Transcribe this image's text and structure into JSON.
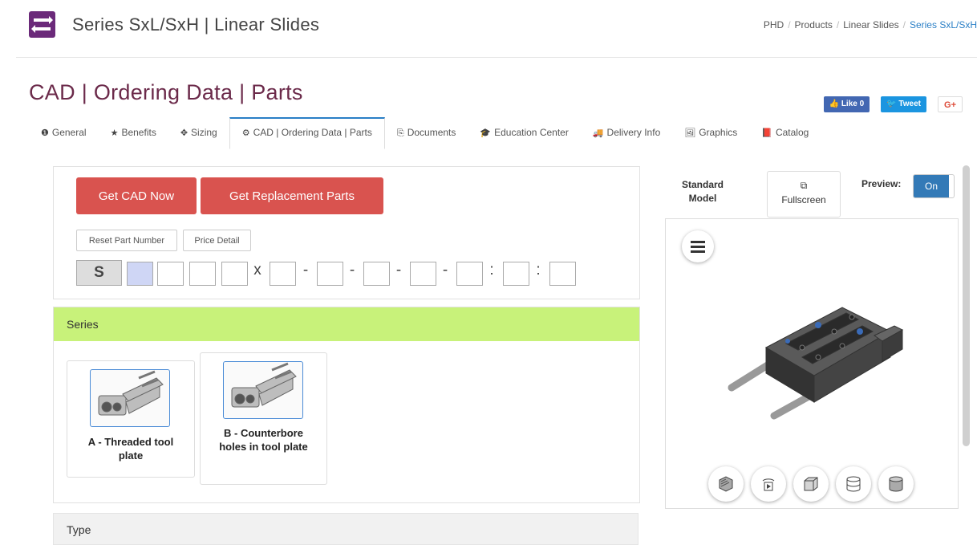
{
  "header": {
    "title": "Series SxL/SxH | Linear Slides",
    "breadcrumb": [
      "PHD",
      "Products",
      "Linear Slides",
      "Series SxL/SxH"
    ]
  },
  "page": {
    "title": "CAD | Ordering Data | Parts"
  },
  "social": {
    "like": "Like 0",
    "tweet": "Tweet",
    "gplus": "G+"
  },
  "tabs": [
    {
      "label": "General",
      "icon": "info-icon"
    },
    {
      "label": "Benefits",
      "icon": "star-icon"
    },
    {
      "label": "Sizing",
      "icon": "move-icon"
    },
    {
      "label": "CAD | Ordering Data | Parts",
      "icon": "gears-icon",
      "active": true
    },
    {
      "label": "Documents",
      "icon": "documents-icon"
    },
    {
      "label": "Education Center",
      "icon": "graduation-cap-icon"
    },
    {
      "label": "Delivery Info",
      "icon": "truck-icon"
    },
    {
      "label": "Graphics",
      "icon": "image-icon"
    },
    {
      "label": "Catalog",
      "icon": "book-icon"
    }
  ],
  "actions": {
    "get_cad": "Get CAD Now",
    "get_parts": "Get Replacement Parts",
    "reset": "Reset Part Number",
    "price": "Price Detail"
  },
  "part_number": {
    "prefix": "S",
    "sep_x": "x",
    "sep_dash": "-",
    "sep_colon": ":"
  },
  "series": {
    "heading": "Series",
    "options": [
      {
        "label": "A - Threaded tool plate"
      },
      {
        "label": "B - Counterbore holes in tool plate"
      }
    ]
  },
  "type": {
    "heading": "Type"
  },
  "viewer": {
    "model_label": "Standard Model",
    "fullscreen": "Fullscreen",
    "preview_label": "Preview:",
    "preview_state": "On"
  },
  "colors": {
    "accent": "#2a7fc6",
    "brand": "#6b2a7a",
    "button_red": "#d9534f",
    "series_header": "#c8f27a",
    "toggle_on": "#337ab7"
  }
}
